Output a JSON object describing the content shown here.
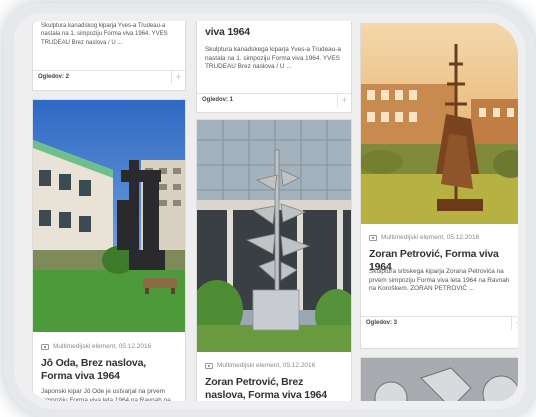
{
  "cards": [
    {
      "id": "top-left",
      "desc": "Skulptura kanadskog kiparja Yves-a Trudeau-a nastala na 1. simpoziju Forma viva 1964. YVES TRUDEAU Brez naslova / U ...",
      "views": "Ogledov: 2"
    },
    {
      "id": "top-middle",
      "title_tail": "viva 1964",
      "desc": "Skulptura kanadskega kiparja Yves-a Trudeau-a nastala na 1. simpoziju Forma viva 1964. YVES TRUDEAU Brez naslova / U ...",
      "views": "Ogledov: 1"
    },
    {
      "id": "jo-oda",
      "meta": "Multimedijski element, 05.12.2016",
      "title": "Jô Oda, Brez naslova, Forma viva 1964",
      "desc": "Japonski kipar Jô Ode je ustvarjal na prvem simpoziju Forma viva leta 1964 na Ravnah na"
    },
    {
      "id": "zoran-1",
      "meta": "Multimedijski element, 05.12.2016",
      "title": "Zoran Petrović, Forma viva 1964",
      "desc": "Skulptura srbskega kiparja Zorana Petrovića na prvem simpoziju Forma viva leta 1964 na Ravnah na Koroškem. ZORAN PETROVIĆ ...",
      "views": "Ogledov: 3"
    },
    {
      "id": "zoran-2",
      "meta": "Multimedijski element, 05.12.2016",
      "title": "Zoran Petrović, Brez naslova, Forma viva 1964"
    }
  ],
  "plus_label": "+"
}
